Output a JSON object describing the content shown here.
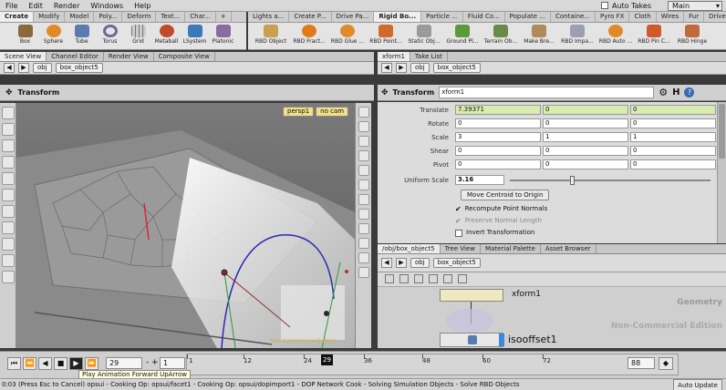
{
  "menubar": {
    "items": [
      "File",
      "Edit",
      "Render",
      "Windows",
      "Help"
    ],
    "auto_takes_label": "Auto Takes",
    "desktop_value": "Main"
  },
  "shelf_left": {
    "tabs": [
      "Create",
      "Modify",
      "Model",
      "Poly...",
      "Deform",
      "Text...",
      "Char...",
      "+"
    ],
    "tools": [
      "Box",
      "Sphere",
      "Tube",
      "Torus",
      "Grid",
      "Metaball",
      "LSystem",
      "Platonic"
    ]
  },
  "shelf_right": {
    "tabs": [
      "Lights a...",
      "Create P...",
      "Drive Pa...",
      "Rigid Bo...",
      "Particle ...",
      "Fluid Co...",
      "Populate ...",
      "Containe...",
      "Pyro FX",
      "Cloth",
      "Wires",
      "Fur",
      "Drive Si..."
    ],
    "tools": [
      "RBD Object",
      "RBD Fract...",
      "RBD Glue ...",
      "RBD Point...",
      "Static Obj...",
      "Ground Pl...",
      "Terrain Ob...",
      "Make Bre...",
      "RBD Impa...",
      "RBD Auto ...",
      "RBD Pin C...",
      "RBD Hinge"
    ]
  },
  "viewer": {
    "tabs": [
      "Scene View",
      "Channel Editor",
      "Render View",
      "Composite View"
    ],
    "path": [
      "obj",
      "box_object5"
    ],
    "toolbar_title": "Transform",
    "camera_label": "persp1",
    "cam_menu": "no cam",
    "watermark": "Non-Commercial Edition"
  },
  "params": {
    "tabs": [
      "xform1",
      "Take List"
    ],
    "path": [
      "obj",
      "box_object5"
    ],
    "node_type": "Transform",
    "node_name": "xform1",
    "rows": [
      {
        "label": "Translate",
        "values": [
          "7.39371",
          "0",
          "0"
        ]
      },
      {
        "label": "Rotate",
        "values": [
          "0",
          "0",
          "0"
        ]
      },
      {
        "label": "Scale",
        "values": [
          "3",
          "1",
          "1"
        ]
      },
      {
        "label": "Shear",
        "values": [
          "0",
          "0",
          "0"
        ]
      },
      {
        "label": "Pivot",
        "values": [
          "0",
          "0",
          "0"
        ]
      }
    ],
    "uniform_scale_label": "Uniform Scale",
    "uniform_scale_value": "3.16",
    "move_centroid_label": "Move Centroid to Origin",
    "recompute_normals": "Recompute Point Normals",
    "preserve_normal_length": "Preserve Normal Length",
    "invert_transformation": "Invert Transformation"
  },
  "network": {
    "tabs": [
      "/obj/box_object5",
      "Tree View",
      "Material Palette",
      "Asset Browser"
    ],
    "path": [
      "obj",
      "box_object5"
    ],
    "geometry_label": "Geometry",
    "node_top": "xform1",
    "node_bottom": "isooffset1",
    "watermark": "Non-Commercial Edition"
  },
  "timeline": {
    "frame_current": "29",
    "frame_start": "1",
    "ticks": [
      "1",
      "12",
      "24",
      "36",
      "48",
      "60",
      "72"
    ],
    "cursor_label": "29",
    "end_value": "88",
    "tooltip": "Play Animation Forward  UpArrow",
    "progress_fraction": 0.5
  },
  "status": {
    "text": "0:03 (Press Esc to Cancel) opsui - Cooking Op:   opsui/facet1 - Cooking Op:   opsui/dopimport1 - DOP Network Cook - Solving Simulation Objects - Solve RBD Objects",
    "auto_update": "Auto Update"
  },
  "colors": {
    "accent_green": "#d9ecb0",
    "viewport_bg": "#6f6f6f",
    "panel_bg": "#dcdcdc"
  }
}
